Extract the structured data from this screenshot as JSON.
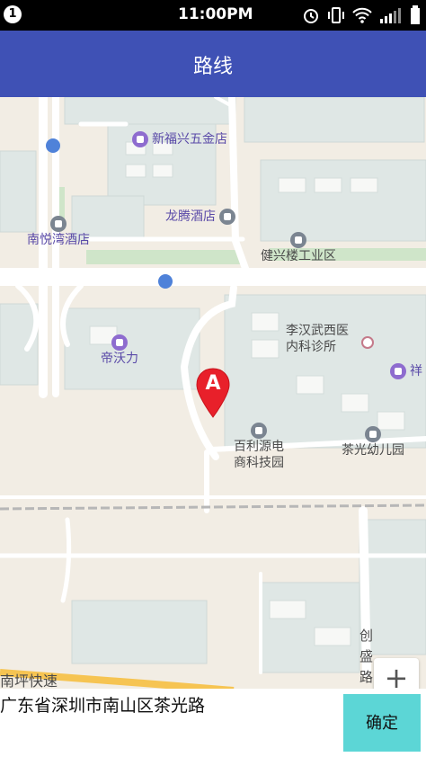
{
  "status_bar": {
    "notification_count": "1",
    "time": "11:00PM"
  },
  "app_bar": {
    "title": "路线"
  },
  "map": {
    "pois": {
      "xinfuxing": "新福兴五金店",
      "longteng": "龙腾酒店",
      "nanyuewan": "南悦湾酒店",
      "jianxinglou": "健兴楼工业区",
      "diwoli": "帝沃力",
      "lihan_line1": "李汉武西医",
      "lihan_line2": "内科诊所",
      "xiang": "祥",
      "bailiyuan_line1": "百利源电",
      "bailiyuan_line2": "商科技园",
      "chaguang": "茶光幼儿园",
      "road_nanping": "南坪快速",
      "road_chuangsheng_1": "创",
      "road_chuangsheng_2": "盛",
      "road_chuangsheng_3": "路"
    },
    "marker_label": "A",
    "zoom_in_label": "+"
  },
  "bottom": {
    "address": "广东省深圳市南山区茶光路",
    "confirm_label": "确定"
  },
  "colors": {
    "app_bar": "#3f51b5",
    "confirm_button": "#5cd6d6",
    "marker": "#e8202a",
    "poi_text": "#5a4aa8"
  }
}
